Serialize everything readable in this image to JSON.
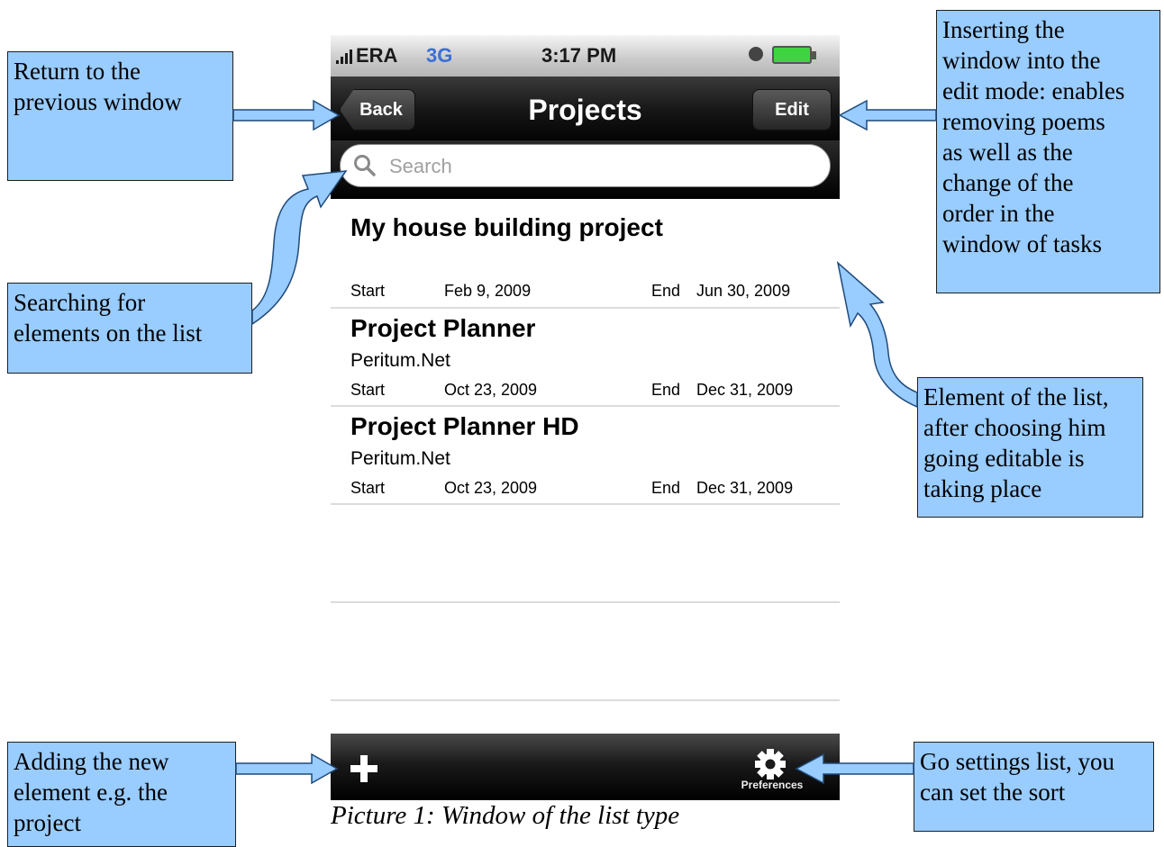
{
  "status_bar": {
    "carrier": "ERA",
    "network": "3G",
    "time": "3:17 PM"
  },
  "nav": {
    "back_label": "Back",
    "title": "Projects",
    "edit_label": "Edit"
  },
  "search": {
    "placeholder": "Search"
  },
  "projects": [
    {
      "name": "My house building project",
      "org": "",
      "start_label": "Start",
      "start": "Feb 9, 2009",
      "end_label": "End",
      "end": "Jun 30, 2009"
    },
    {
      "name": "Project Planner",
      "org": "Peritum.Net",
      "start_label": "Start",
      "start": "Oct 23, 2009",
      "end_label": "End",
      "end": "Dec 31, 2009"
    },
    {
      "name": "Project Planner HD",
      "org": "Peritum.Net",
      "start_label": "Start",
      "start": "Oct 23, 2009",
      "end_label": "End",
      "end": "Dec 31, 2009"
    }
  ],
  "toolbar": {
    "add_icon": "plus-icon",
    "preferences_icon": "gear-icon",
    "preferences_label": "Preferences"
  },
  "callouts": {
    "back": "Return to the\nprevious window",
    "edit": "Inserting the\nwindow into the\nedit mode: enables\nremoving poems\nas well as the\nchange of the\norder in the\nwindow of tasks",
    "search": "Searching for\nelements on the list",
    "list": "Element of the list,\nafter choosing him\ngoing editable is\ntaking place",
    "add": "Adding the new\nelement e.g. the\nproject",
    "preferences": "Go settings list, you\ncan set the sort"
  },
  "caption": "Picture 1: Window of the list type",
  "colors": {
    "callout_fill": "#99ccff",
    "network_blue": "#3a6fd6"
  }
}
